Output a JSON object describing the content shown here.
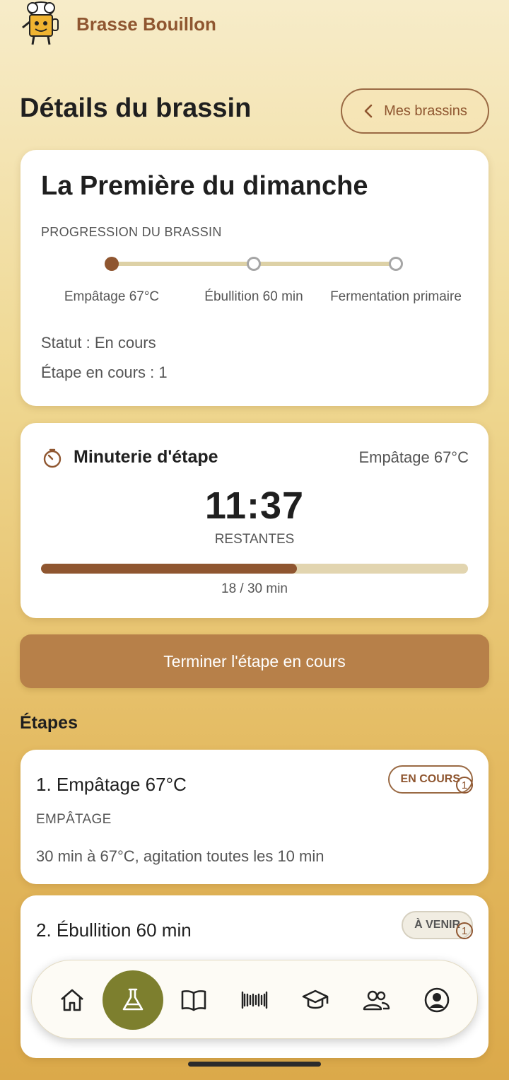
{
  "app": {
    "name": "Brasse Bouillon"
  },
  "header": {
    "title": "Détails du brassin",
    "back_label": "Mes brassins"
  },
  "brew": {
    "name": "La Première du dimanche",
    "progress_label": "PROGRESSION DU BRASSIN",
    "steps": [
      "Empâtage 67°C",
      "Ébullition 60 min",
      "Fermentation primaire"
    ],
    "status": "Statut : En cours",
    "current_step": "Étape en cours : 1"
  },
  "timer": {
    "title": "Minuterie d'étape",
    "step": "Empâtage 67°C",
    "value": "11:37",
    "remaining_label": "RESTANTES",
    "progress_text": "18 / 30 min",
    "elapsed_min": 18,
    "total_min": 30
  },
  "actions": {
    "finish_label": "Terminer l'étape en cours"
  },
  "steps_section": {
    "title": "Étapes",
    "items": [
      {
        "title": "1. Empâtage 67°C",
        "type": "EMPÂTAGE",
        "description": "30 min à 67°C, agitation toutes les 10 min",
        "badge": "EN COURS",
        "badge_num": "1"
      },
      {
        "title": "2. Ébullition 60 min",
        "badge": "À VENIR",
        "badge_num": "1"
      }
    ]
  },
  "nav": {
    "items": [
      "home-icon",
      "flask-icon",
      "book-icon",
      "barcode-icon",
      "graduation-cap-icon",
      "users-icon",
      "user-circle-icon"
    ],
    "active": "flask-icon"
  },
  "colors": {
    "accent": "#8f5630",
    "button": "#b78049",
    "nav_active": "#7d7f2e"
  }
}
